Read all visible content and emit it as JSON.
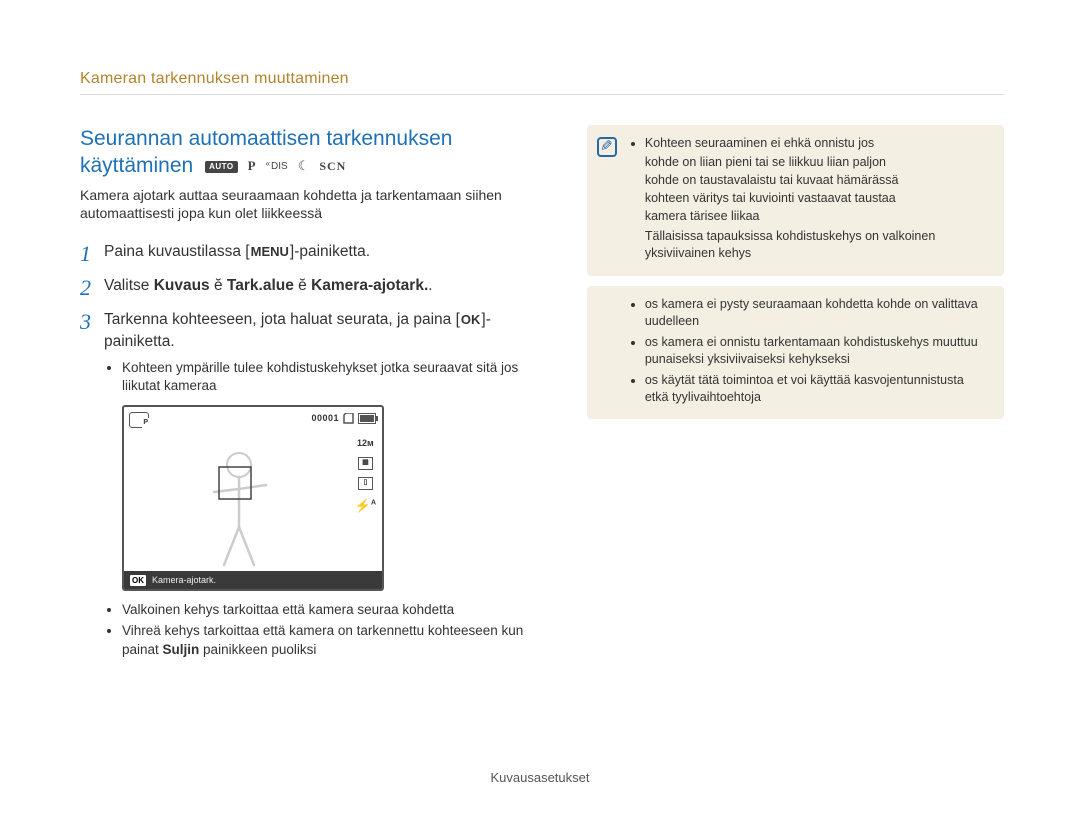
{
  "header": {
    "breadcrumb": "Kameran tarkennuksen muuttaminen"
  },
  "section": {
    "title_line1": "Seurannan automaattisen tarkennuksen",
    "title_line2": "käyttäminen",
    "modes": {
      "auto": "AUTO",
      "p": "P",
      "dis": "DIS",
      "scn": "SCN"
    },
    "intro": "Kamera ajotark  auttaa seuraamaan kohdetta ja tarkentamaan siihen automaattisesti  jopa kun olet liikkeessä"
  },
  "steps": {
    "s1_a": "Paina kuvaustilassa [",
    "s1_menu": "MENU",
    "s1_b": "]-painiketta.",
    "s2_a": "Valitse ",
    "s2_path1": "Kuvaus",
    "s2_arrow": " ĕ  ",
    "s2_path2": "Tark.alue",
    "s2_path3": " Kamera-ajotark.",
    "s2_dot": ".",
    "s3_a": "Tarkenna kohteeseen, jota haluat seurata, ja paina [",
    "s3_ok": "OK",
    "s3_b": "]-painiketta."
  },
  "sub_after_s3": [
    "Kohteen ympärille tulee kohdistuskehykset  jotka seuraavat sitä  jos liikutat kameraa"
  ],
  "lcd": {
    "counter": "00001",
    "res": "12ᴍ",
    "flash": "A",
    "ok": "OK",
    "bottom_label": "Kamera-ajotark."
  },
  "sub_after_lcd": [
    "Valkoinen kehys tarkoittaa  että kamera seuraa kohdetta",
    {
      "pre": "Vihreä kehys tarkoittaa  että kamera on tarkennettu kohteeseen  kun painat  ",
      "bold": "Suljin",
      "post": "  painikkeen puoliksi"
    }
  ],
  "notes": {
    "box1": {
      "lead": "Kohteen seuraaminen ei ehkä onnistu  jos",
      "reasons": [
        "kohde on liian pieni tai se liikkuu liian paljon",
        "kohde on taustavalaistu tai kuvaat hämärässä",
        "kohteen väritys tai kuviointi vastaavat taustaa",
        "kamera tärisee liikaa"
      ],
      "tail": "Tällaisissa tapauksissa kohdistuskehys on valkoinen yksiviivainen kehys"
    },
    "box2": [
      "os kamera ei pysty seuraamaan kohdetta  kohde on valittava uudelleen",
      "os kamera ei onnistu tarkentamaan  kohdistuskehys muuttuu punaiseksi yksiviivaiseksi kehykseksi",
      "os käytät tätä toimintoa  et voi käyttää kasvojentunnistusta etkä tyylivaihtoehtoja"
    ]
  },
  "footer": "Kuvausasetukset"
}
